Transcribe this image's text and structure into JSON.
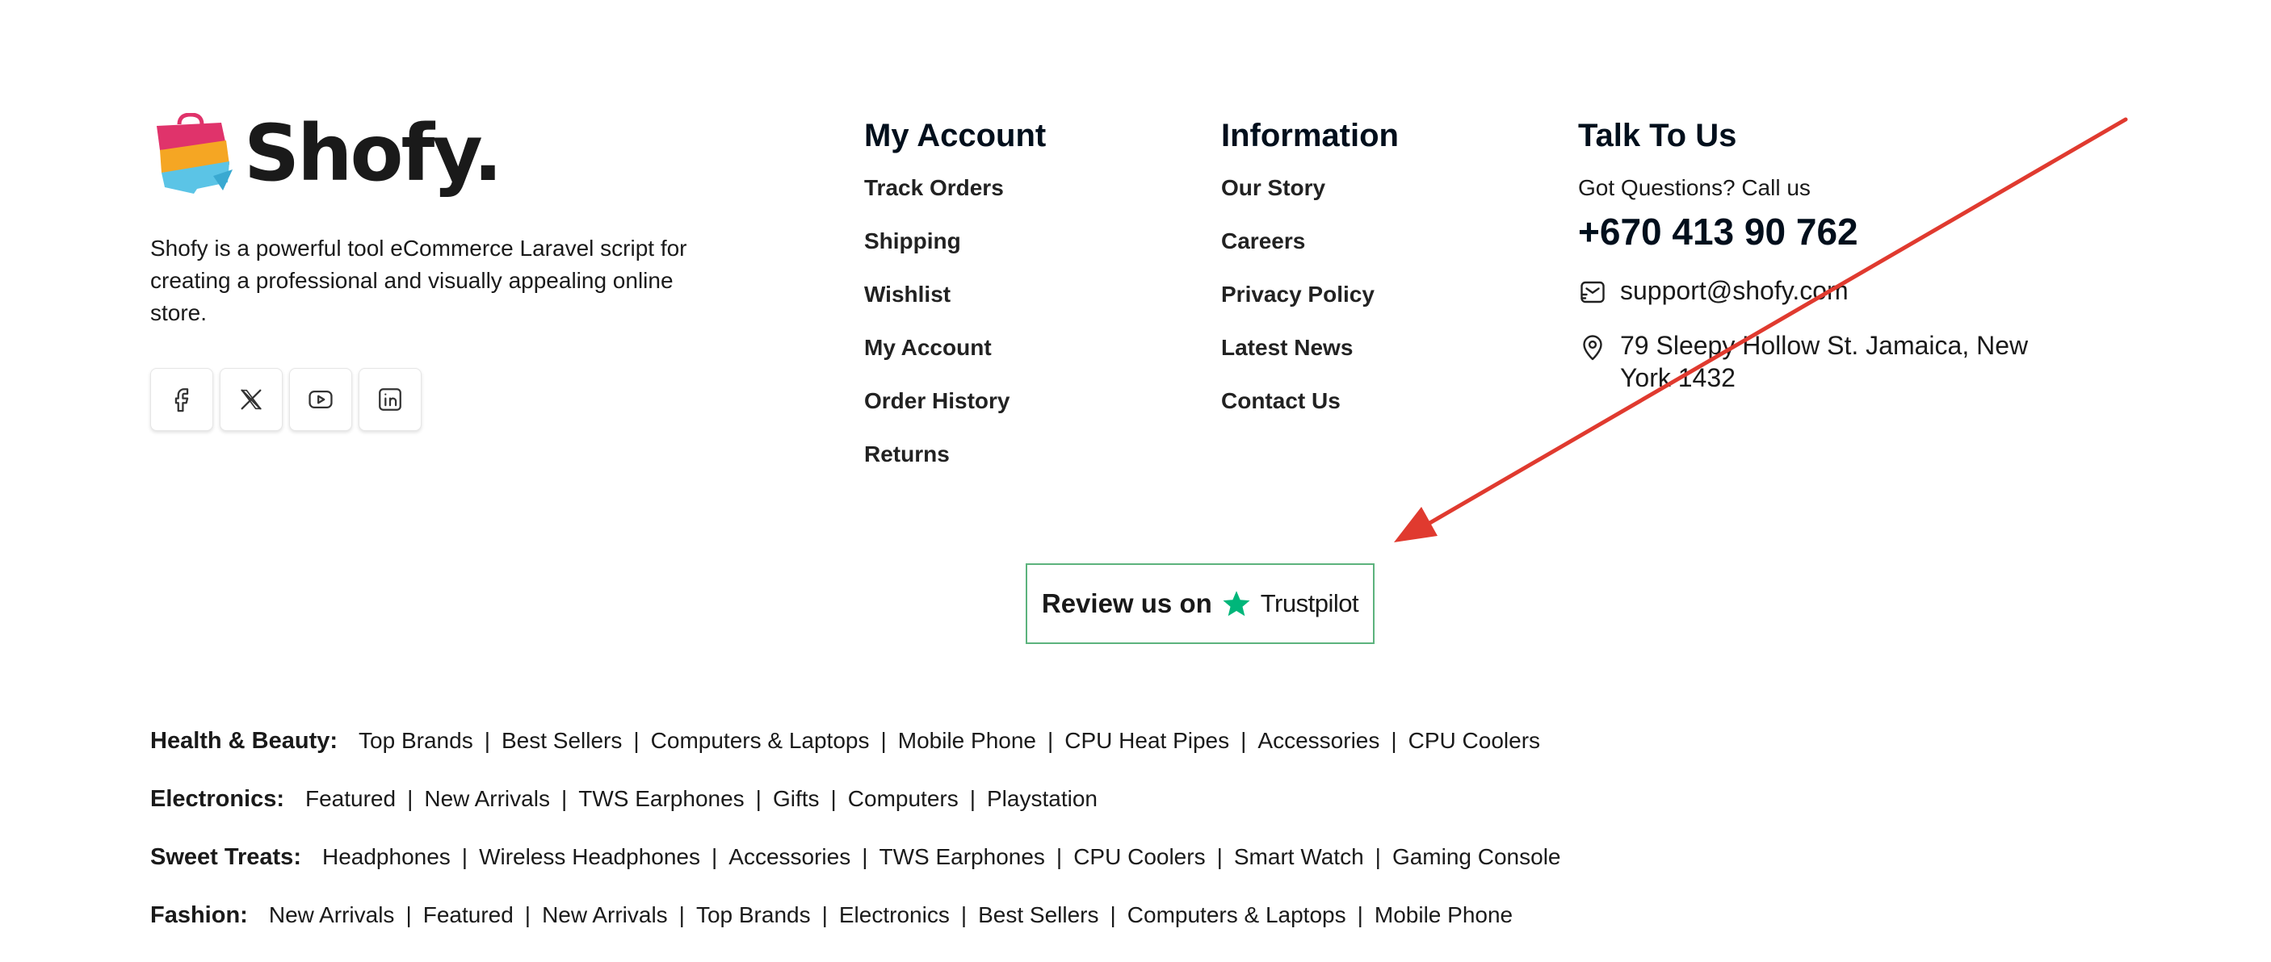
{
  "brand": {
    "name": "Shofy.",
    "description": "Shofy is a powerful tool eCommerce Laravel script for creating a professional and visually appealing online store.",
    "colors": [
      "#e0336b",
      "#f5a623",
      "#5bc4e6"
    ]
  },
  "socials": [
    {
      "icon": "facebook-icon"
    },
    {
      "icon": "x-icon"
    },
    {
      "icon": "youtube-icon"
    },
    {
      "icon": "linkedin-icon"
    }
  ],
  "my_account": {
    "title": "My Account",
    "links": [
      "Track Orders",
      "Shipping",
      "Wishlist",
      "My Account",
      "Order History",
      "Returns"
    ]
  },
  "information": {
    "title": "Information",
    "links": [
      "Our Story",
      "Careers",
      "Privacy Policy",
      "Latest News",
      "Contact Us"
    ]
  },
  "talk": {
    "title": "Talk To Us",
    "subtitle": "Got Questions? Call us",
    "phone": "+670 413 90 762",
    "email": "support@shofy.com",
    "address": "79 Sleepy Hollow St. Jamaica, New York 1432"
  },
  "trustpilot": {
    "review_label": "Review us on",
    "brand": "Trustpilot",
    "accent": "#00b67a"
  },
  "annotation_arrow": {
    "color": "#e03a2f"
  },
  "categories": [
    {
      "title": "Health & Beauty:",
      "links": [
        "Top Brands",
        "Best Sellers",
        "Computers & Laptops",
        "Mobile Phone",
        "CPU Heat Pipes",
        "Accessories",
        "CPU Coolers"
      ]
    },
    {
      "title": "Electronics:",
      "links": [
        "Featured",
        "New Arrivals",
        "TWS Earphones",
        "Gifts",
        "Computers",
        "Playstation"
      ]
    },
    {
      "title": "Sweet Treats:",
      "links": [
        "Headphones",
        "Wireless Headphones",
        "Accessories",
        "TWS Earphones",
        "CPU Coolers",
        "Smart Watch",
        "Gaming Console"
      ]
    },
    {
      "title": "Fashion:",
      "links": [
        "New Arrivals",
        "Featured",
        "New Arrivals",
        "Top Brands",
        "Electronics",
        "Best Sellers",
        "Computers & Laptops",
        "Mobile Phone"
      ]
    }
  ]
}
